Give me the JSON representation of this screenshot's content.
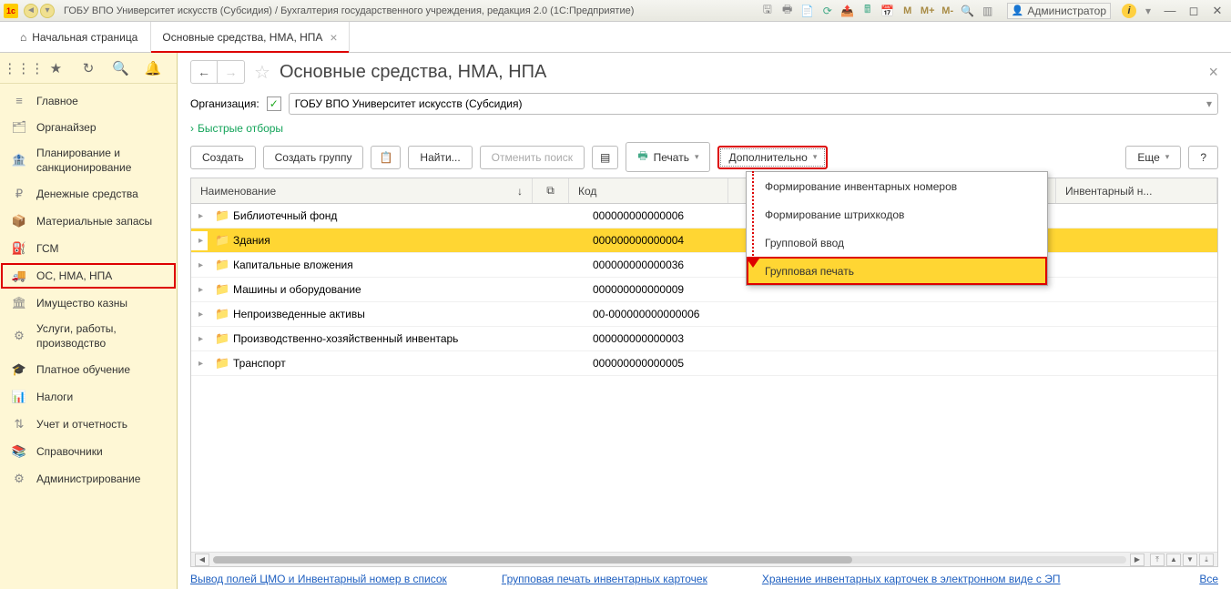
{
  "titlebar": {
    "title": "ГОБУ ВПО Университет искусств (Субсидия) / Бухгалтерия государственного учреждения, редакция 2.0  (1С:Предприятие)",
    "m_labels": [
      "M",
      "M+",
      "M-"
    ],
    "admin": "Администратор"
  },
  "tabs": {
    "home": "Начальная страница",
    "active": "Основные средства, НМА, НПА"
  },
  "sidebar": {
    "items": [
      {
        "label": "Главное"
      },
      {
        "label": "Органайзер"
      },
      {
        "label": "Планирование и санкционирование"
      },
      {
        "label": "Денежные средства"
      },
      {
        "label": "Материальные запасы"
      },
      {
        "label": "ГСМ"
      },
      {
        "label": "ОС, НМА, НПА"
      },
      {
        "label": "Имущество казны"
      },
      {
        "label": "Услуги, работы, производство"
      },
      {
        "label": "Платное обучение"
      },
      {
        "label": "Налоги"
      },
      {
        "label": "Учет и отчетность"
      },
      {
        "label": "Справочники"
      },
      {
        "label": "Администрирование"
      }
    ]
  },
  "page": {
    "title": "Основные средства, НМА, НПА",
    "org_label": "Организация:",
    "org_value": "ГОБУ ВПО Университет искусств (Субсидия)",
    "quick_filters": "Быстрые отборы"
  },
  "toolbar": {
    "create": "Создать",
    "create_group": "Создать группу",
    "find": "Найти...",
    "cancel_search": "Отменить поиск",
    "print": "Печать",
    "additional": "Дополнительно",
    "more": "Еще",
    "help": "?"
  },
  "dropdown": {
    "items": [
      "Формирование инвентарных номеров",
      "Формирование штрихкодов",
      "Групповой ввод",
      "Групповая печать"
    ]
  },
  "table": {
    "headers": {
      "name": "Наименование",
      "code": "Код",
      "inv": "Инвентарный н..."
    },
    "rows": [
      {
        "name": "Библиотечный фонд",
        "code": "000000000000006"
      },
      {
        "name": "Здания",
        "code": "000000000000004"
      },
      {
        "name": "Капитальные вложения",
        "code": "000000000000036"
      },
      {
        "name": "Машины и оборудование",
        "code": "000000000000009"
      },
      {
        "name": "Непроизведенные активы",
        "code": "00-000000000000006"
      },
      {
        "name": "Производственно-хозяйственный инвентарь",
        "code": "000000000000003"
      },
      {
        "name": "Транспорт",
        "code": "000000000000005"
      }
    ]
  },
  "footer": {
    "link1": "Вывод полей ЦМО и Инвентарный номер в список",
    "link2": "Групповая печать инвентарных карточек",
    "link3": "Хранение инвентарных карточек в электронном виде с ЭП",
    "all": "Все"
  }
}
